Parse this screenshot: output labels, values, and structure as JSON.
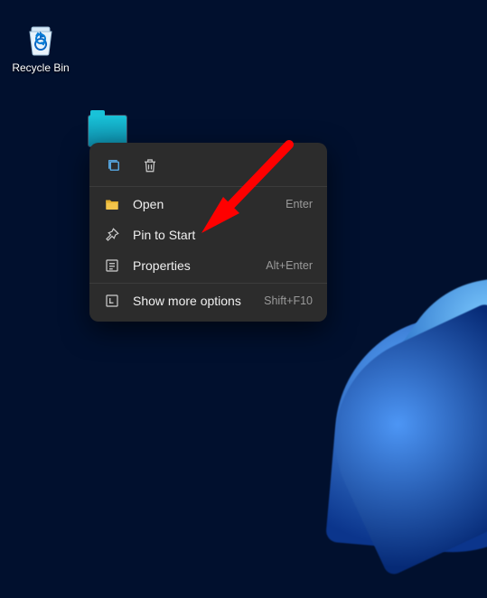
{
  "desktop": {
    "recycle_bin_label": "Recycle Bin"
  },
  "context_menu": {
    "items": [
      {
        "label": "Open",
        "shortcut": "Enter"
      },
      {
        "label": "Pin to Start",
        "shortcut": ""
      },
      {
        "label": "Properties",
        "shortcut": "Alt+Enter"
      },
      {
        "label": "Show more options",
        "shortcut": "Shift+F10"
      }
    ]
  },
  "annotation": {
    "arrow_color": "#ff0000"
  }
}
